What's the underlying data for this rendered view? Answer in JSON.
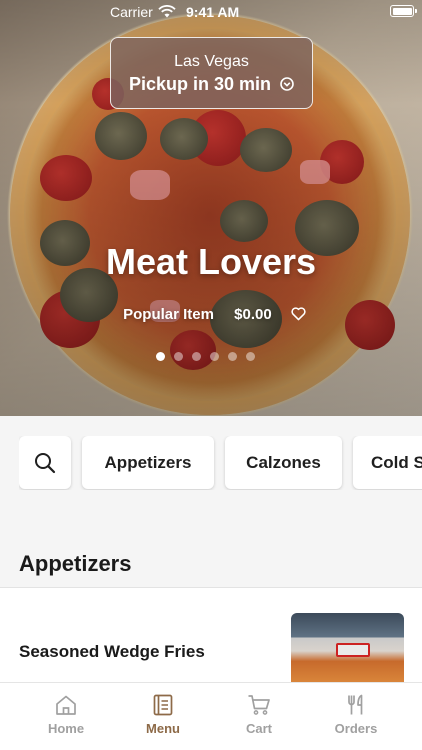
{
  "status_bar": {
    "carrier": "Carrier",
    "time": "9:41 AM"
  },
  "location": {
    "city": "Las Vegas",
    "pickup": "Pickup in 30 min"
  },
  "featured": {
    "title": "Meat Lovers",
    "tag": "Popular Item",
    "price": "$0.00",
    "carousel_total": 6,
    "carousel_active": 1
  },
  "categories": [
    "Appetizers",
    "Calzones",
    "Cold S"
  ],
  "section": {
    "title": "Appetizers"
  },
  "items": [
    {
      "name": "Seasoned Wedge Fries"
    }
  ],
  "tabs": [
    {
      "label": "Home",
      "icon": "home-icon",
      "active": false
    },
    {
      "label": "Menu",
      "icon": "menu-icon",
      "active": true
    },
    {
      "label": "Cart",
      "icon": "cart-icon",
      "active": false
    },
    {
      "label": "Orders",
      "icon": "fork-knife-icon",
      "active": false
    }
  ],
  "colors": {
    "accent": "#8d6a48",
    "inactive": "#a0a0a0"
  }
}
